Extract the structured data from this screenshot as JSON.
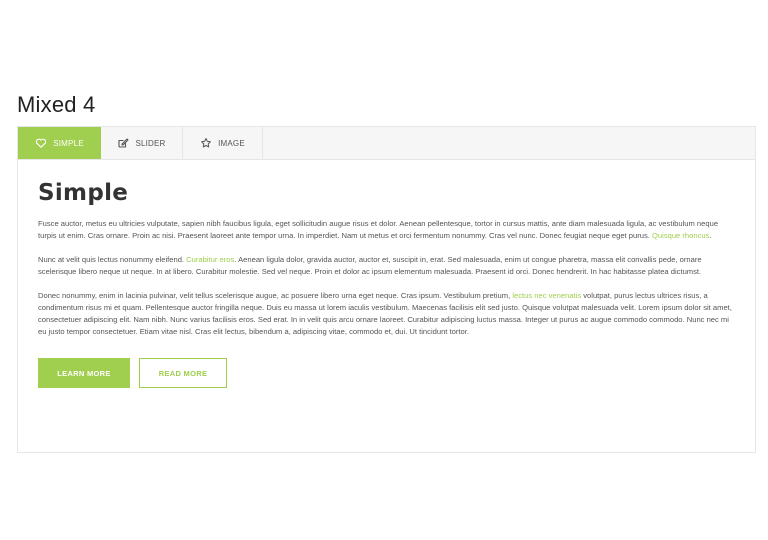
{
  "section_title": "Mixed 4",
  "tabs": [
    {
      "label": "SIMPLE",
      "icon": "heart-icon",
      "active": true
    },
    {
      "label": "SLIDER",
      "icon": "edit-icon",
      "active": false
    },
    {
      "label": "IMAGE",
      "icon": "star-icon",
      "active": false
    }
  ],
  "content": {
    "heading": "Simple",
    "p1_text": "Fusce auctor, metus eu ultricies vulputate, sapien nibh faucibus ligula, eget sollicitudin augue risus et dolor. Aenean pellentesque, tortor in cursus mattis, ante diam malesuada ligula, ac vestibulum neque turpis ut enim. Cras ornare. Proin ac nisi. Praesent laoreet ante tempor urna. In imperdiet. Nam ut metus et orci fermentum nonummy. Cras vel nunc. Donec feugiat neque eget purus.",
    "p1_link": "Quisque rhoncus",
    "p1_end": ".",
    "p2_start": "Nunc at velit quis lectus nonummy eleifend.",
    "p2_link": "Curabitur eros",
    "p2_end": ". Aenean ligula dolor, gravida auctor, auctor et, suscipit in, erat. Sed malesuada, enim ut congue pharetra, massa elit convallis pede, ornare scelerisque libero neque ut neque. In at libero. Curabitur molestie. Sed vel neque. Proin et dolor ac ipsum elementum malesuada. Praesent id orci. Donec hendrerit. In hac habitasse platea dictumst.",
    "p3_start": "Donec nonummy, enim in lacinia pulvinar, velit tellus scelerisque augue, ac posuere libero urna eget neque. Cras ipsum. Vestibulum pretium,",
    "p3_link": "lectus nec venenatis",
    "p3_end": "volutpat, purus lectus ultrices risus, a condimentum risus mi et quam. Pellentesque auctor fringilla neque. Duis eu massa ut lorem iaculis vestibulum. Maecenas facilisis elit sed justo. Quisque volutpat malesuada velit. Lorem ipsum dolor sit amet, consectetuer adipiscing elit. Nam nibh. Nunc varius facilisis eros. Sed erat. In in velit quis arcu ornare laoreet. Curabitur adipiscing luctus massa. Integer ut purus ac augue commodo commodo. Nunc nec mi eu justo tempor consectetuer. Etiam vitae nisl. Cras elit lectus, bibendum a, adipiscing vitae, commodo et, dui. Ut tincidunt tortor."
  },
  "buttons": {
    "primary_label": "LEARN MORE",
    "outline_label": "READ MORE"
  },
  "colors": {
    "accent": "#a0ce4e",
    "tab_bar_bg": "#f6f6f6",
    "border": "#e6e6e6",
    "body_text": "#555555"
  }
}
